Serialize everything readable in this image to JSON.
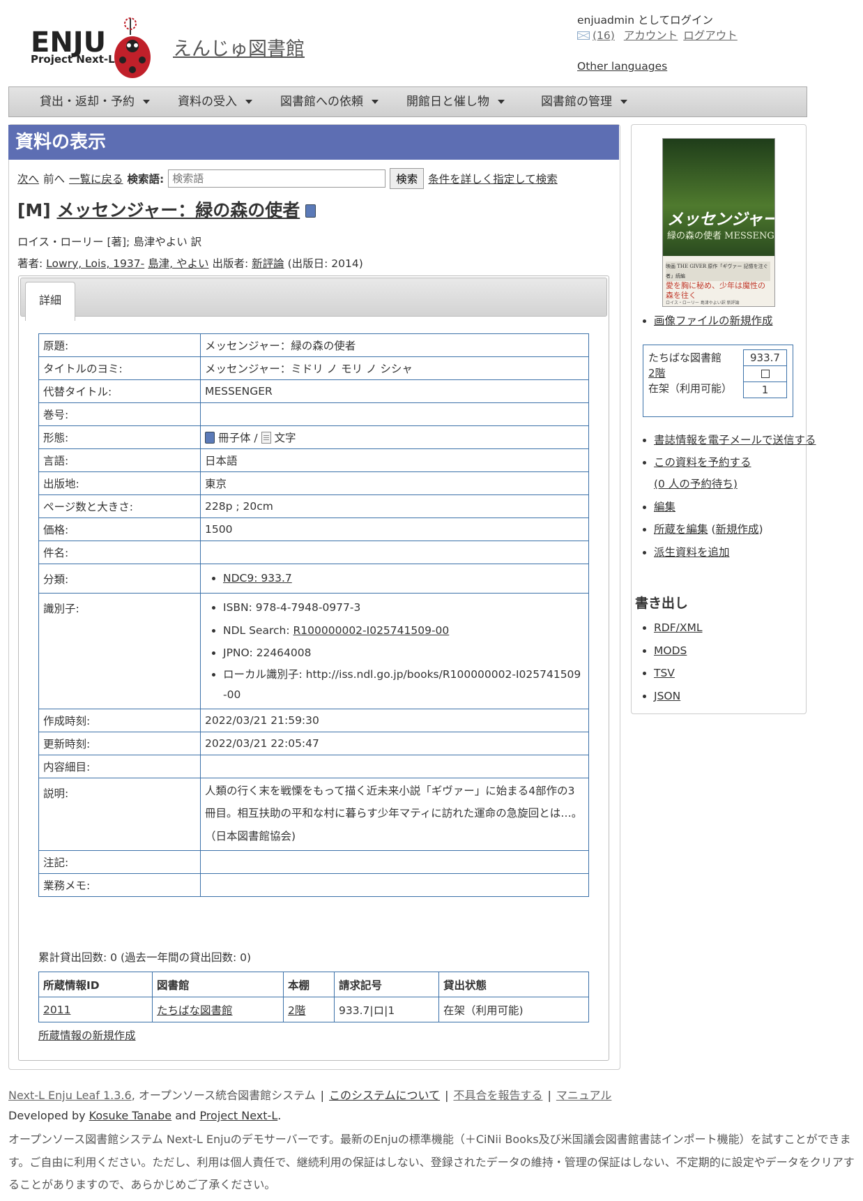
{
  "header": {
    "logo_text": "ENJU",
    "logo_sub": "Project Next-L",
    "site_name": "えんじゅ図書館",
    "login_text": "enjuadmin としてログイン",
    "mail_count": "(16)",
    "account_link": "アカウント",
    "logout_link": "ログアウト",
    "other_languages": "Other languages"
  },
  "nav": {
    "items": [
      {
        "label": "貸出・返却・予約"
      },
      {
        "label": "資料の受入"
      },
      {
        "label": "図書館への依頼"
      },
      {
        "label": "開館日と催し物"
      },
      {
        "label": "図書館の管理"
      }
    ]
  },
  "page": {
    "heading": "資料の表示",
    "next_link": "次へ",
    "prev_label": "前へ",
    "back_link": "一覧に戻る",
    "search_label": "検索語:",
    "search_placeholder": "検索語",
    "search_button": "検索",
    "advanced_search": "条件を詳しく指定して検索"
  },
  "book": {
    "title_prefix": "[M]",
    "title": "メッセンジャー：緑の森の使者",
    "responsibility": "ロイス・ローリー [著]; 島津やよい 訳",
    "creators_label": "著者:",
    "creator1": "Lowry, Lois, 1937-",
    "creator2": "島津, やよい",
    "publisher_label": "出版者:",
    "publisher": "新評論",
    "pubdate": "(出版日: 2014)"
  },
  "tabs": {
    "detail": "詳細"
  },
  "details": {
    "original_title_k": "原題:",
    "original_title_v": "メッセンジャー：緑の森の使者",
    "title_yomi_k": "タイトルのヨミ:",
    "title_yomi_v": "メッセンジャー：ミドリ ノ モリ ノ シシャ",
    "alt_title_k": "代替タイトル:",
    "alt_title_v": "MESSENGER",
    "volume_k": "巻号:",
    "form_k": "形態:",
    "form_carrier": "冊子体 /",
    "form_content": "文字",
    "language_k": "言語:",
    "language_v": "日本語",
    "place_k": "出版地:",
    "place_v": "東京",
    "extent_k": "ページ数と大きさ:",
    "extent_v": "228p ; 20cm",
    "price_k": "価格:",
    "price_v": "1500",
    "subject_k": "件名:",
    "classification_k": "分類:",
    "classification_v": "NDC9: 933.7",
    "identifier_k": "識別子:",
    "isbn": "ISBN: 978-4-7948-0977-3",
    "ndl_label": "NDL Search:",
    "ndl_link": "R100000002-I025741509-00",
    "jpno": "JPNO: 22464008",
    "local_id": "ローカル識別子: http://iss.ndl.go.jp/books/R100000002-I025741509-00",
    "created_k": "作成時刻:",
    "created_v": "2022/03/21 21:59:30",
    "updated_k": "更新時刻:",
    "updated_v": "2022/03/21 22:05:47",
    "contents_k": "内容細目:",
    "description_k": "説明:",
    "description_v": "人類の行く末を戦慄をもって描く近未来小説「ギヴァー」に始まる4部作の3冊目。相互扶助の平和な村に暮らす少年マティに訪れた運命の急旋回とは…。（日本図書館協会)",
    "note_k": "注記:",
    "memo_k": "業務メモ:"
  },
  "checkout_count": "累計貸出回数: 0 (過去一年間の貸出回数: 0)",
  "holdings": {
    "headers": [
      "所蔵情報ID",
      "図書館",
      "本棚",
      "請求記号",
      "貸出状態"
    ],
    "rows": [
      {
        "id": "2011",
        "library": "たちばな図書館",
        "shelf": "2階",
        "call_number": "933.7|ロ|1",
        "status": "在架（利用可能)"
      }
    ],
    "new_item": "所蔵情報の新規作成"
  },
  "sidebar": {
    "cover_title": "メッセンジャー",
    "cover_subtitle": "緑の森の使者 MESSENGER",
    "cover_tagline": "愛を胸に秘め、少年は魔性の森を往く",
    "cover_band": "映画 THE GIVER 原作「ギヴァー 記憶を注ぐ者」続編",
    "cover_small": "ロイス・ローリー 島津やよい訳 新評論",
    "new_image": "画像ファイルの新規作成",
    "avail_library": "たちばな図書館",
    "avail_shelf": "2階",
    "avail_status": "在架（利用可能）",
    "avail_callno": "933.7",
    "avail_count": "1",
    "email_link": "書誌情報を電子メールで送信する",
    "reserve_link": "この資料を予約する",
    "reserve_count": "(0 人の予約待ち)",
    "edit": "編集",
    "edit_items": "所蔵を編集",
    "new_items": "新規作成",
    "add_derived": "派生資料を追加",
    "export_heading": "書き出し",
    "exports": [
      "RDF/XML",
      "MODS",
      "TSV",
      "JSON"
    ]
  },
  "footer": {
    "product": "Next-L Enju Leaf 1.3.6",
    "product_desc": ", オープンソース統合図書館システム",
    "about": "このシステムについて",
    "bug": "不具合を報告する",
    "manual": "マニュアル",
    "developed_by": "Developed by",
    "dev1": "Kosuke Tanabe",
    "and": "and",
    "dev2": "Project Next-L",
    "notice": "オープンソース図書館システム Next-L Enjuのデモサーバーです。最新のEnjuの標準機能（＋CiNii Books及び米国議会図書館書誌インポート機能）を試すことができます。ご自由に利用ください。ただし、利用は個人責任で、継続利用の保証はしない、登録されたデータの維持・管理の保証はしない、不定期的に設定やデータをクリアすることがありますので、あらかじめご了承ください。"
  },
  "colors": {
    "heading_bg": "#5d6eb3",
    "table_border": "#3a70a8",
    "logo_red": "#c0202a"
  }
}
